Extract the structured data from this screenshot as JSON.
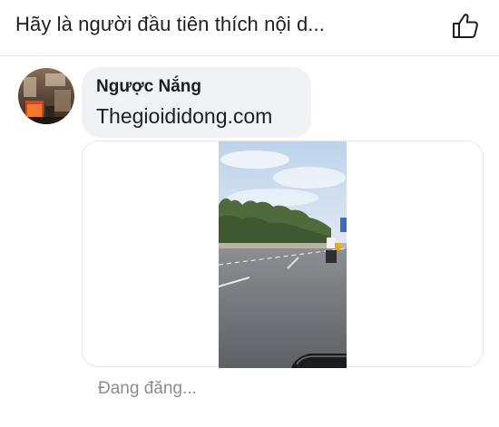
{
  "header": {
    "text": "Hãy là người đầu tiên thích nội d...",
    "like_icon": "thumbs-up-icon"
  },
  "comment": {
    "author": "Ngược Nắng",
    "text": "Thegioididong.com",
    "avatar_icon": "user-avatar"
  },
  "attachment": {
    "media_type": "video-thumbnail"
  },
  "status": {
    "text": "Đang đăng..."
  },
  "colors": {
    "text_primary": "#1c1e21",
    "bubble_bg": "#f0f2f5",
    "status_text": "#8a8d91",
    "border": "#e4e6eb"
  }
}
